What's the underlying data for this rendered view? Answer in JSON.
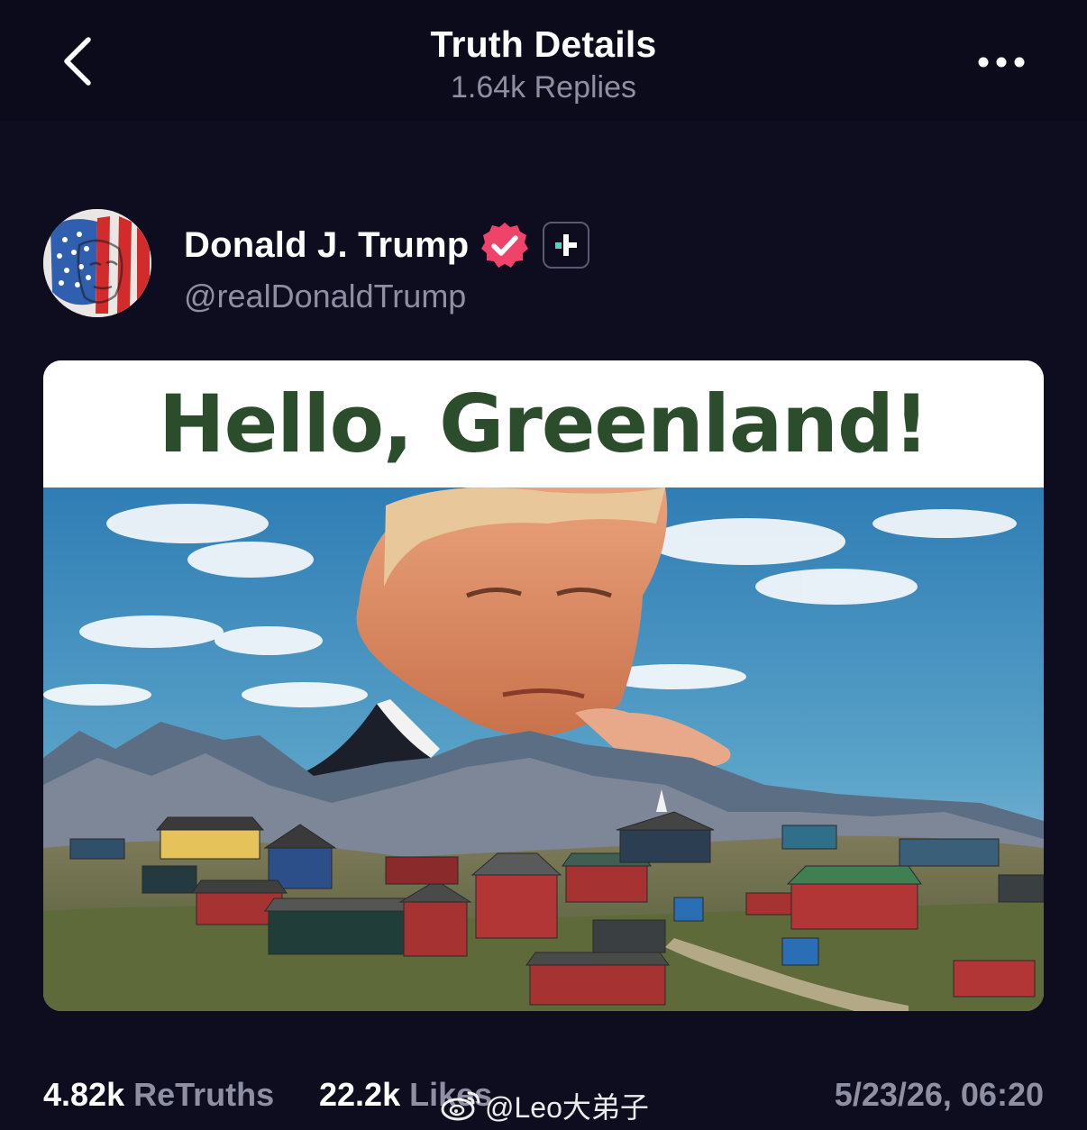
{
  "header": {
    "title": "Truth Details",
    "subtitle": "1.64k Replies",
    "back_icon": "chevron-left-icon",
    "more_icon": "ellipsis-horizontal-icon"
  },
  "author": {
    "name": "Donald J. Trump",
    "handle": "@realDonaldTrump",
    "verified_icon": "verified-badge-icon",
    "verified_color": "#f0436a",
    "plus_icon": "plus-badge-icon"
  },
  "media": {
    "banner_text": "Hello, Greenland!",
    "banner_color": "#2c4d2c",
    "scene": "greenland-village-image"
  },
  "stats": {
    "retruths_count": "4.82k",
    "retruths_label": "ReTruths",
    "likes_count": "22.2k",
    "likes_label": "Likes",
    "timestamp": "5/23/26, 06:20"
  },
  "watermark": {
    "text": "@Leo大弟子",
    "icon": "weibo-logo-icon"
  },
  "colors": {
    "background": "#0e0c1f",
    "muted_text": "#8f8fa4",
    "primary_text": "#ffffff"
  }
}
